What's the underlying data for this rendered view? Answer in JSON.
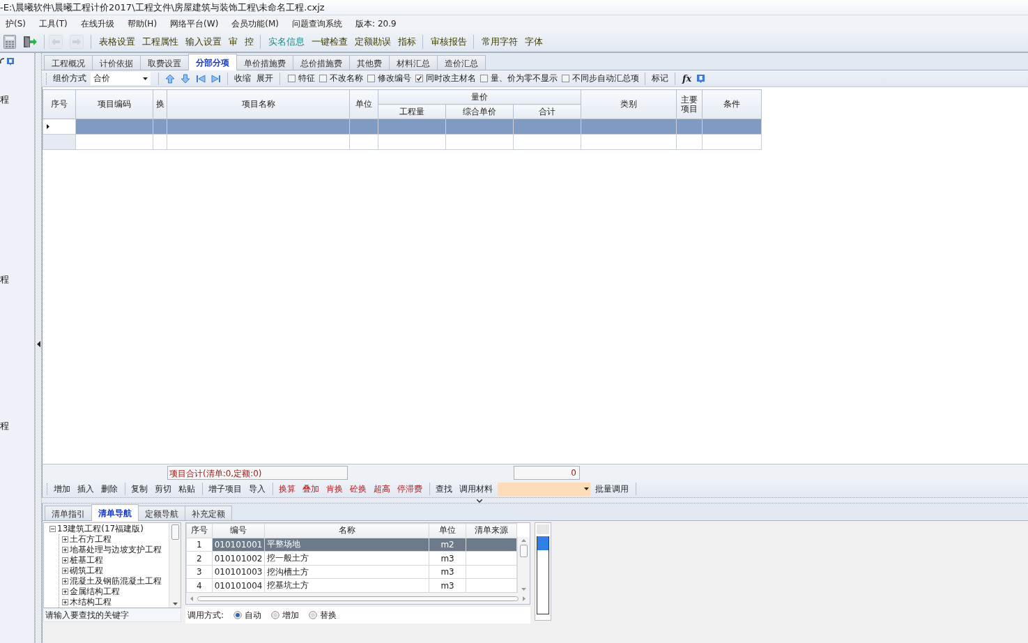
{
  "window": {
    "title": "-E:\\晨曦软件\\晨曦工程计价2017\\工程文件\\房屋建筑与装饰工程\\未命名工程.cxjz"
  },
  "menu": [
    "护(S)",
    "工具(T)",
    "在线升级",
    "帮助(H)",
    "网络平台(W)",
    "会员功能(M)",
    "问题查询系统",
    "版本: 20.9"
  ],
  "toolbar": {
    "icons": [
      {
        "kind": "calculator",
        "disabled": false
      },
      {
        "kind": "exit",
        "disabled": false
      },
      {
        "kind": "back",
        "disabled": true
      },
      {
        "kind": "forward",
        "disabled": true
      }
    ],
    "groups": [
      [
        {
          "label": "表格设置",
          "kind": "normal"
        },
        {
          "label": "工程属性",
          "kind": "normal"
        },
        {
          "label": "输入设置",
          "kind": "normal"
        },
        {
          "label": "审",
          "kind": "normal"
        },
        {
          "label": "控",
          "kind": "normal"
        }
      ],
      [
        {
          "label": "实名信息",
          "kind": "accent"
        },
        {
          "label": "一键检查",
          "kind": "normal"
        },
        {
          "label": "定额勘误",
          "kind": "normal"
        },
        {
          "label": "指标",
          "kind": "normal"
        }
      ],
      [
        {
          "label": "审核报告",
          "kind": "normal"
        }
      ],
      [
        {
          "label": "常用字符",
          "kind": "normal"
        },
        {
          "label": "字体",
          "kind": "normal"
        }
      ]
    ]
  },
  "side_panel": {
    "labels": [
      "程",
      "程",
      "程"
    ]
  },
  "tabs": [
    {
      "label": "工程概况",
      "selected": false
    },
    {
      "label": "计价依据",
      "selected": false
    },
    {
      "label": "取费设置",
      "selected": false
    },
    {
      "label": "分部分项",
      "selected": true
    },
    {
      "label": "单价措施费",
      "selected": false
    },
    {
      "label": "总价措施费",
      "selected": false
    },
    {
      "label": "其他费",
      "selected": false
    },
    {
      "label": "材料汇总",
      "selected": false
    },
    {
      "label": "造价汇总",
      "selected": false
    }
  ],
  "pricing_toolbar": {
    "method_label": "组价方式",
    "method_value": "合价",
    "buttons": [
      "收缩",
      "展开"
    ],
    "checkboxes": [
      {
        "label": "特征",
        "checked": false
      },
      {
        "label": "不改名称",
        "checked": false
      },
      {
        "label": "修改编号",
        "checked": false
      },
      {
        "label": "同时改主材名",
        "checked": true
      },
      {
        "label": "量、价为零不显示",
        "checked": false
      },
      {
        "label": "不同步自动汇总项",
        "checked": false
      }
    ],
    "mark_button": "标记",
    "formula_button": "fx"
  },
  "grid": {
    "columns": [
      {
        "label": "序号"
      },
      {
        "label": "项目编码"
      },
      {
        "label": "换"
      },
      {
        "label": "项目名称"
      },
      {
        "label": "单位"
      },
      {
        "label": "量价",
        "children": [
          {
            "label": "工程量"
          },
          {
            "label": "综合单价"
          },
          {
            "label": "合计"
          }
        ]
      },
      {
        "label": "类别"
      },
      {
        "label": "主要项目"
      },
      {
        "label": "条件"
      }
    ],
    "rows": [
      {
        "selected": true
      },
      {
        "selected": false
      }
    ]
  },
  "summary": {
    "text": "项目合计(清单:0,定额:0)",
    "total": "0"
  },
  "edit_toolbar": {
    "groups": [
      [
        {
          "label": "增加",
          "kind": "normal"
        },
        {
          "label": "插入",
          "kind": "normal"
        },
        {
          "label": "删除",
          "kind": "normal"
        }
      ],
      [
        {
          "label": "复制",
          "kind": "normal"
        },
        {
          "label": "剪切",
          "kind": "normal"
        },
        {
          "label": "粘贴",
          "kind": "normal"
        }
      ],
      [
        {
          "label": "增子项目",
          "kind": "normal"
        },
        {
          "label": "导入",
          "kind": "normal"
        }
      ],
      [
        {
          "label": "换算",
          "kind": "special"
        },
        {
          "label": "叠加",
          "kind": "special"
        },
        {
          "label": "肯换",
          "kind": "special"
        },
        {
          "label": "砼换",
          "kind": "special"
        },
        {
          "label": "超高",
          "kind": "special"
        },
        {
          "label": "停滞费",
          "kind": "special"
        }
      ],
      [
        {
          "label": "查找",
          "kind": "normal"
        },
        {
          "label": "调用材料",
          "kind": "normal"
        }
      ]
    ],
    "batch_button": "批量调用"
  },
  "nav_tabs": [
    {
      "label": "清单指引",
      "selected": false
    },
    {
      "label": "清单导航",
      "selected": true
    },
    {
      "label": "定额导航",
      "selected": false
    },
    {
      "label": "补充定额",
      "selected": false
    }
  ],
  "tree": {
    "label": "13建筑工程(17福建版)",
    "expanded": true,
    "children": [
      {
        "label": "土石方工程",
        "expanded": false
      },
      {
        "label": "地基处理与边坡支护工程",
        "expanded": false
      },
      {
        "label": "桩基工程",
        "expanded": false
      },
      {
        "label": "砌筑工程",
        "expanded": false
      },
      {
        "label": "混凝土及钢筋混凝土工程",
        "expanded": false
      },
      {
        "label": "金属结构工程",
        "expanded": false
      },
      {
        "label": "木结构工程",
        "expanded": false
      }
    ]
  },
  "search": {
    "placeholder": "请输入要查找的关键字"
  },
  "list": {
    "columns": [
      "序号",
      "编号",
      "名称",
      "单位",
      "清单来源"
    ],
    "rows": [
      {
        "no": "1",
        "code": "010101001",
        "name": "平整场地",
        "unit": "m2",
        "selected": true
      },
      {
        "no": "2",
        "code": "010101002",
        "name": "挖一般土方",
        "unit": "m3",
        "selected": false
      },
      {
        "no": "3",
        "code": "010101003",
        "name": "挖沟槽土方",
        "unit": "m3",
        "selected": false
      },
      {
        "no": "4",
        "code": "010101004",
        "name": "挖基坑土方",
        "unit": "m3",
        "selected": false
      }
    ]
  },
  "call_mode": {
    "label": "调用方式:",
    "options": [
      {
        "label": "自动",
        "selected": true
      },
      {
        "label": "增加",
        "selected": false
      },
      {
        "label": "替换",
        "selected": false
      }
    ]
  }
}
